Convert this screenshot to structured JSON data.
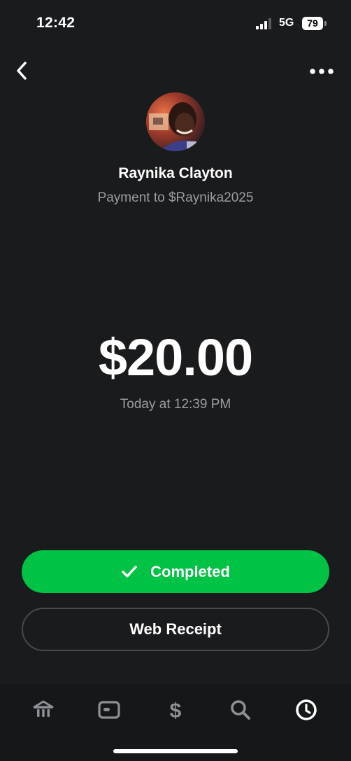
{
  "status_bar": {
    "time": "12:42",
    "network": "5G",
    "battery": "79"
  },
  "nav": {
    "back_icon": "chevron-left-icon",
    "more_icon": "ellipsis-icon"
  },
  "payment": {
    "recipient_name": "Raynika Clayton",
    "subtitle": "Payment to $Raynika2025",
    "amount": "$20.00",
    "timestamp": "Today at 12:39 PM"
  },
  "actions": {
    "status_label": "Completed",
    "receipt_label": "Web Receipt"
  },
  "colors": {
    "background": "#1a1b1d",
    "accent_green": "#00c244",
    "muted_text": "#9b9da1"
  },
  "tabs": [
    {
      "icon": "bank-icon",
      "active": false
    },
    {
      "icon": "card-icon",
      "active": false
    },
    {
      "icon": "dollar-icon",
      "active": false
    },
    {
      "icon": "search-icon",
      "active": false
    },
    {
      "icon": "clock-icon",
      "active": true
    }
  ]
}
